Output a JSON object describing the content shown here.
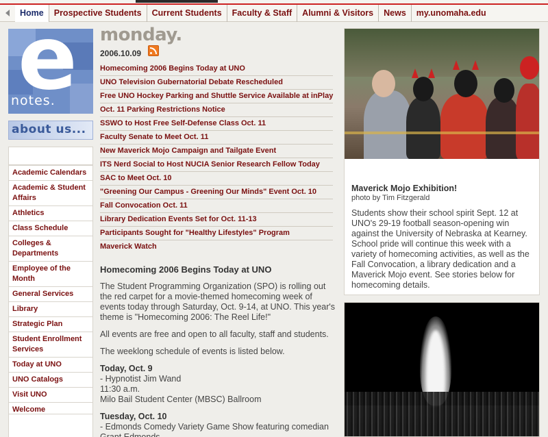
{
  "nav": {
    "items": [
      {
        "label": "Home",
        "active": true
      },
      {
        "label": "Prospective Students",
        "active": false
      },
      {
        "label": "Current Students",
        "active": false
      },
      {
        "label": "Faculty & Staff",
        "active": false
      },
      {
        "label": "Alumni & Visitors",
        "active": false
      },
      {
        "label": "News",
        "active": false
      },
      {
        "label": "my.unomaha.edu",
        "active": false
      }
    ]
  },
  "logo": {
    "letter": "e",
    "text": "notes."
  },
  "about": {
    "label": "about us..."
  },
  "sidebar": {
    "items": [
      {
        "label": "Academic Calendars"
      },
      {
        "label": "Academic & Student Affairs"
      },
      {
        "label": "Athletics"
      },
      {
        "label": "Class Schedule"
      },
      {
        "label": "Colleges & Departments"
      },
      {
        "label": "Employee of the Month"
      },
      {
        "label": "General Services"
      },
      {
        "label": "Library"
      },
      {
        "label": "Strategic Plan"
      },
      {
        "label": "Student Enrollment Services"
      },
      {
        "label": "Today at UNO"
      },
      {
        "label": "UNO Catalogs"
      },
      {
        "label": "Visit UNO"
      },
      {
        "label": "Welcome"
      }
    ]
  },
  "issue": {
    "day": "monday.",
    "date": "2006.10.09"
  },
  "headlines": [
    "Homecoming 2006 Begins Today at UNO",
    "UNO Television Gubernatorial Debate Rescheduled",
    "Free UNO Hockey Parking and Shuttle Service Available at inPlay",
    "Oct. 11 Parking Restrictions Notice",
    "SSWO to Host Free Self-Defense Class Oct. 11",
    "Faculty Senate to Meet Oct. 11",
    "New Maverick Mojo Campaign and Tailgate Event",
    "ITS Nerd Social to Host NUCIA Senior Research Fellow Today",
    "SAC to Meet Oct. 10",
    "\"Greening Our Campus - Greening Our Minds\" Event Oct. 10",
    "Fall Convocation Oct. 11",
    "Library Dedication Events Set for Oct. 11-13",
    "Participants Sought for \"Healthy Lifestyles\" Program",
    "Maverick Watch"
  ],
  "story": {
    "title": "Homecoming 2006 Begins Today at UNO",
    "p1": "The Student Programming Organization (SPO) is rolling out the red carpet for a movie-themed homecoming week of events today through Saturday, Oct. 9-14, at UNO. This year's theme is \"Homecoming 2006: The Reel Life!\"",
    "p2": "All events are free and open to all faculty, staff and students.",
    "p3": "The weeklong schedule of events is listed below.",
    "events": [
      {
        "day": "Today, Oct. 9",
        "lines": [
          "- Hypnotist Jim Wand",
          "11:30 a.m.",
          "Milo Bail Student Center (MBSC) Ballroom"
        ]
      },
      {
        "day": "Tuesday, Oct. 10",
        "lines": [
          "- Edmonds Comedy Variety Game Show featuring comedian Grant Edmonds"
        ]
      }
    ]
  },
  "feature": {
    "title": "Maverick Mojo Exhibition!",
    "credit": "photo by Tim Fitzgerald",
    "body": "Students show their school spirit Sept. 12 at UNO's 29-19 football season-opening win against the University of Nebraska at Kearney. School pride will continue this week with a variety of homecoming activities, as well as the Fall Convocation, a library dedication and a Maverick Mojo event. See stories below for homecoming details."
  },
  "colors": {
    "accent": "#7a1010",
    "nav_active_text": "#1a2a6a",
    "background": "#efeeea",
    "logo_blue": "#6f8fc8"
  }
}
